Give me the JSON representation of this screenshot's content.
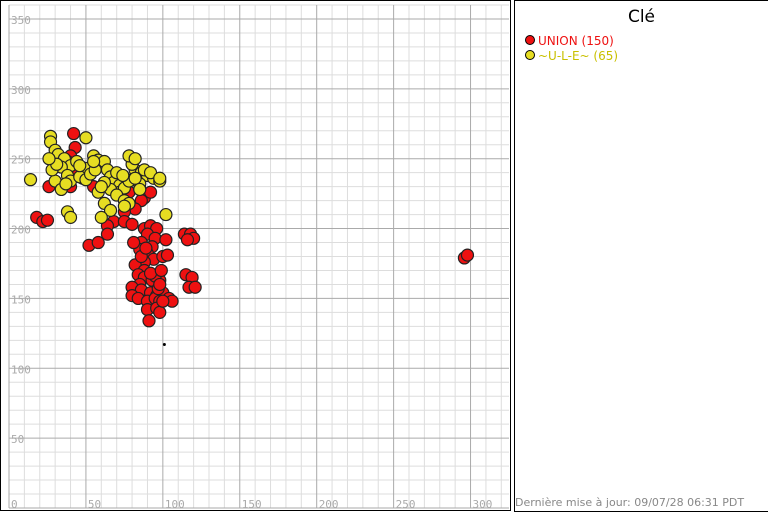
{
  "chart_data": {
    "type": "scatter",
    "xlim": [
      0,
      325
    ],
    "ylim": [
      0,
      360
    ],
    "x_ticks": [
      0,
      50,
      100,
      150,
      200,
      250,
      300
    ],
    "y_ticks": [
      50,
      100,
      150,
      200,
      250,
      300,
      350
    ],
    "grid": true,
    "legend_title": "Clé",
    "series": [
      {
        "name": "UNION (150)",
        "color": "#ee1111",
        "points": [
          [
            42,
            268
          ],
          [
            43,
            258
          ],
          [
            40,
            252
          ],
          [
            38,
            248
          ],
          [
            42,
            242
          ],
          [
            48,
            236
          ],
          [
            40,
            230
          ],
          [
            26,
            230
          ],
          [
            18,
            208
          ],
          [
            22,
            205
          ],
          [
            25,
            206
          ],
          [
            55,
            230
          ],
          [
            65,
            230
          ],
          [
            72,
            238
          ],
          [
            80,
            235
          ],
          [
            78,
            226
          ],
          [
            85,
            228
          ],
          [
            88,
            222
          ],
          [
            92,
            226
          ],
          [
            86,
            220
          ],
          [
            82,
            214
          ],
          [
            75,
            212
          ],
          [
            68,
            205
          ],
          [
            75,
            205
          ],
          [
            80,
            203
          ],
          [
            64,
            202
          ],
          [
            64,
            196
          ],
          [
            52,
            188
          ],
          [
            58,
            190
          ],
          [
            88,
            200
          ],
          [
            92,
            202
          ],
          [
            96,
            200
          ],
          [
            90,
            196
          ],
          [
            95,
            193
          ],
          [
            86,
            190
          ],
          [
            93,
            187
          ],
          [
            85,
            185
          ],
          [
            90,
            182
          ],
          [
            94,
            178
          ],
          [
            88,
            176
          ],
          [
            82,
            174
          ],
          [
            88,
            170
          ],
          [
            84,
            167
          ],
          [
            88,
            165
          ],
          [
            93,
            163
          ],
          [
            98,
            163
          ],
          [
            95,
            166
          ],
          [
            85,
            160
          ],
          [
            80,
            158
          ],
          [
            86,
            156
          ],
          [
            92,
            154
          ],
          [
            96,
            152
          ],
          [
            100,
            154
          ],
          [
            80,
            152
          ],
          [
            84,
            150
          ],
          [
            90,
            148
          ],
          [
            95,
            150
          ],
          [
            98,
            148
          ],
          [
            104,
            150
          ],
          [
            106,
            148
          ],
          [
            90,
            142
          ],
          [
            96,
            143
          ],
          [
            98,
            140
          ],
          [
            91,
            134
          ],
          [
            100,
            180
          ],
          [
            103,
            181
          ],
          [
            102,
            192
          ],
          [
            114,
            196
          ],
          [
            118,
            196
          ],
          [
            120,
            193
          ],
          [
            116,
            192
          ],
          [
            115,
            167
          ],
          [
            119,
            165
          ],
          [
            117,
            158
          ],
          [
            121,
            158
          ],
          [
            100,
            148
          ],
          [
            97,
            157
          ],
          [
            98,
            160
          ],
          [
            92,
            168
          ],
          [
            86,
            180
          ],
          [
            89,
            186
          ],
          [
            81,
            190
          ],
          [
            99,
            170
          ],
          [
            296,
            179
          ],
          [
            298,
            181
          ]
        ]
      },
      {
        "name": "~U-L-E~ (65)",
        "color": "#e6dd22",
        "points": [
          [
            27,
            266
          ],
          [
            27,
            262
          ],
          [
            30,
            256
          ],
          [
            32,
            253
          ],
          [
            36,
            250
          ],
          [
            40,
            245
          ],
          [
            44,
            248
          ],
          [
            50,
            243
          ],
          [
            55,
            252
          ],
          [
            58,
            249
          ],
          [
            62,
            248
          ],
          [
            34,
            244
          ],
          [
            38,
            238
          ],
          [
            40,
            234
          ],
          [
            46,
            237
          ],
          [
            50,
            235
          ],
          [
            53,
            239
          ],
          [
            56,
            242
          ],
          [
            64,
            242
          ],
          [
            66,
            237
          ],
          [
            68,
            233
          ],
          [
            72,
            231
          ],
          [
            72,
            226
          ],
          [
            75,
            229
          ],
          [
            78,
            234
          ],
          [
            82,
            242
          ],
          [
            86,
            240
          ],
          [
            90,
            238
          ],
          [
            94,
            236
          ],
          [
            98,
            234
          ],
          [
            80,
            246
          ],
          [
            78,
            252
          ],
          [
            82,
            250
          ],
          [
            66,
            228
          ],
          [
            70,
            224
          ],
          [
            75,
            220
          ],
          [
            78,
            218
          ],
          [
            62,
            218
          ],
          [
            66,
            213
          ],
          [
            60,
            208
          ],
          [
            75,
            216
          ],
          [
            85,
            232
          ],
          [
            88,
            242
          ],
          [
            30,
            234
          ],
          [
            34,
            228
          ],
          [
            37,
            232
          ],
          [
            38,
            212
          ],
          [
            40,
            208
          ],
          [
            14,
            235
          ],
          [
            28,
            242
          ],
          [
            31,
            246
          ],
          [
            92,
            240
          ],
          [
            98,
            236
          ],
          [
            102,
            210
          ],
          [
            55,
            248
          ],
          [
            62,
            233
          ],
          [
            70,
            240
          ],
          [
            58,
            226
          ],
          [
            82,
            236
          ],
          [
            85,
            228
          ],
          [
            74,
            238
          ],
          [
            46,
            245
          ],
          [
            26,
            250
          ],
          [
            50,
            265
          ],
          [
            60,
            230
          ]
        ]
      }
    ]
  },
  "legend": {
    "title": "Clé",
    "items": [
      {
        "label": "UNION (150)",
        "color": "#ee1111"
      },
      {
        "label": "~U-L-E~ (65)",
        "color": "#e6dd22"
      }
    ]
  },
  "footer": {
    "text": "Dernière mise à jour: 09/07/28 06:31 PDT"
  }
}
